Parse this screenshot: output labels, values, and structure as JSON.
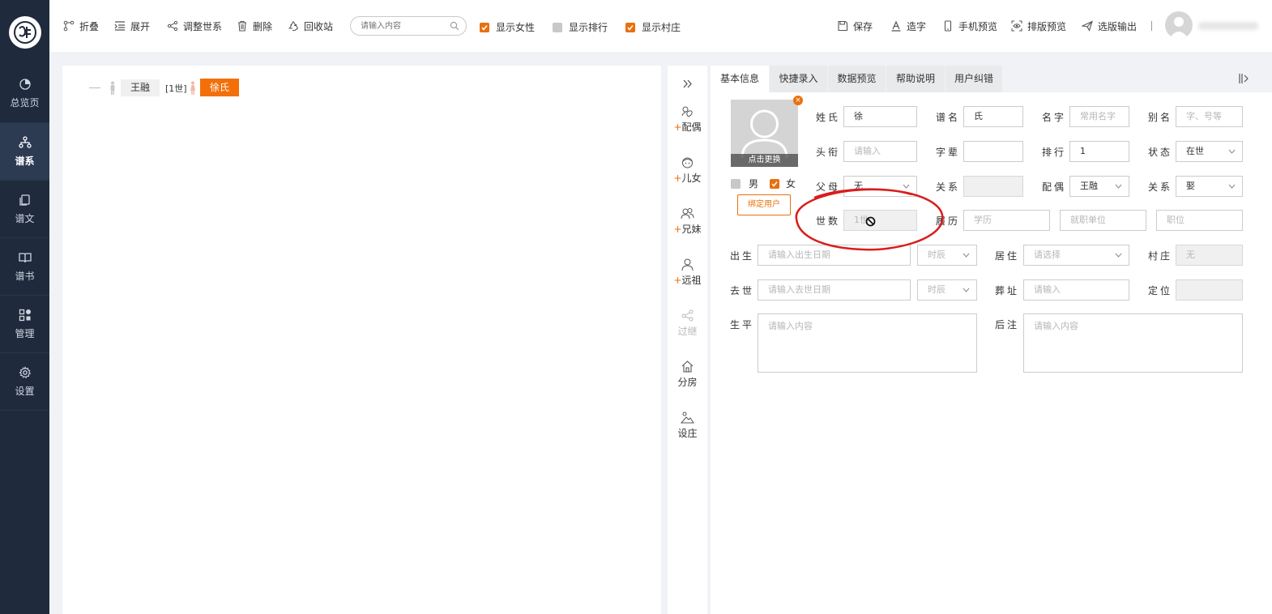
{
  "sidebar": {
    "items": [
      {
        "label": "总览页",
        "icon": "pie-chart-icon"
      },
      {
        "label": "谱系",
        "icon": "tree-icon",
        "active": true
      },
      {
        "label": "谱文",
        "icon": "document-icon"
      },
      {
        "label": "谱书",
        "icon": "book-icon"
      },
      {
        "label": "管理",
        "icon": "grid-icon"
      },
      {
        "label": "设置",
        "icon": "gear-icon"
      }
    ]
  },
  "toolbar": {
    "collapse": "折叠",
    "expand": "展开",
    "adjust_generation": "调整世系",
    "delete": "删除",
    "recycle_bin": "回收站",
    "search_placeholder": "请输入内容",
    "show_female": "显示女性",
    "show_rank": "显示排行",
    "show_village": "显示村庄",
    "save": "保存",
    "create_char": "造字",
    "mobile_preview": "手机预览",
    "layout_preview": "排版预览",
    "select_output": "选版输出"
  },
  "tree": {
    "root_name": "王融",
    "generation": "[1世]",
    "spouse_name": "徐氏"
  },
  "relations": {
    "spouse": "配偶",
    "children": "儿女",
    "siblings": "兄妹",
    "ancestor": "远祖",
    "adopt": "过继",
    "branch": "分房",
    "village": "设庄"
  },
  "tabs": [
    "基本信息",
    "快捷录入",
    "数据预览",
    "帮助说明",
    "用户纠错"
  ],
  "profile": {
    "photo_caption": "点击更换",
    "gender_male": "男",
    "gender_female": "女",
    "bind_user": "绑定用户"
  },
  "form": {
    "surname": {
      "label": "姓氏",
      "value": "徐"
    },
    "pu_name": {
      "label": "谱名",
      "value": "氏"
    },
    "given_name": {
      "label": "名字",
      "placeholder": "常用名字"
    },
    "alias": {
      "label": "别名",
      "placeholder": "字、号等"
    },
    "title": {
      "label": "头衔",
      "placeholder": "请输入"
    },
    "zibei": {
      "label": "字辈",
      "value": ""
    },
    "rank": {
      "label": "排行",
      "value": "1"
    },
    "status": {
      "label": "状态",
      "value": "在世"
    },
    "parents": {
      "label": "父母",
      "value": "无"
    },
    "relation1": {
      "label": "关系",
      "value": ""
    },
    "spouse": {
      "label": "配偶",
      "value": "王融"
    },
    "relation2": {
      "label": "关系",
      "value": "娶"
    },
    "generation": {
      "label": "世数",
      "value": "1世"
    },
    "resume": {
      "label": "履历"
    },
    "education": {
      "placeholder": "学历"
    },
    "employer": {
      "placeholder": "就职单位"
    },
    "position": {
      "placeholder": "职位"
    },
    "birth": {
      "label": "出生",
      "placeholder": "请输入出生日期",
      "hour": "时辰"
    },
    "residence": {
      "label": "居住",
      "placeholder": "请选择"
    },
    "village": {
      "label": "村庄",
      "value": "无"
    },
    "death": {
      "label": "去世",
      "placeholder": "请输入去世日期",
      "hour": "时辰"
    },
    "burial": {
      "label": "葬址",
      "placeholder": "请输入"
    },
    "location": {
      "label": "定位",
      "value": ""
    },
    "biography": {
      "label": "生平",
      "placeholder": "请输入内容"
    },
    "notes": {
      "label": "后注",
      "placeholder": "请输入内容"
    }
  },
  "colors": {
    "accent": "#e9700c",
    "sidebar_bg": "#1f2a3c",
    "annotation": "#d91d1d"
  }
}
